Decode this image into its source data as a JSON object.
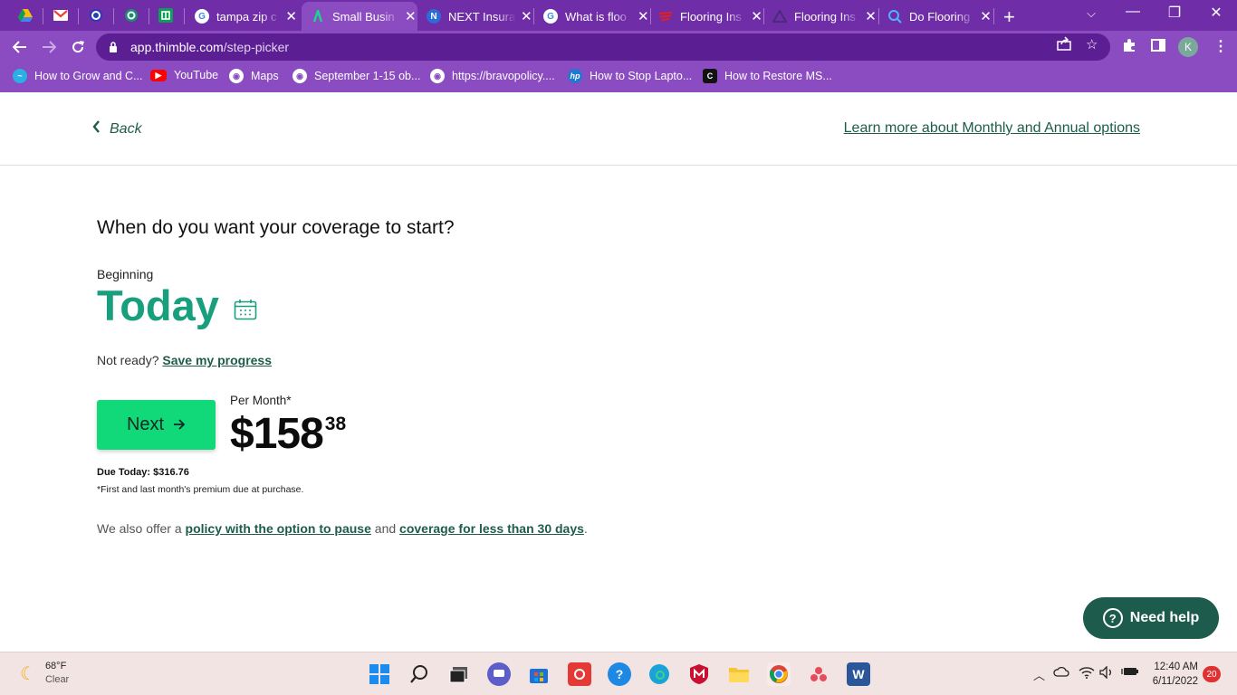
{
  "browser": {
    "tabs": [
      {
        "title": "tampa zip c",
        "favicon": "google-icon",
        "active": false
      },
      {
        "title": "Small Busin",
        "favicon": "thimble-icon",
        "active": true
      },
      {
        "title": "NEXT Insura",
        "favicon": "next-icon",
        "active": false
      },
      {
        "title": "What is floo",
        "favicon": "google-icon",
        "active": false
      },
      {
        "title": "Flooring Ins",
        "favicon": "flooring-icon",
        "active": false
      },
      {
        "title": "Flooring Ins",
        "favicon": "triangle-icon",
        "active": false
      },
      {
        "title": "Do Flooring",
        "favicon": "search-icon",
        "active": false
      }
    ],
    "url_host": "app.thimble.com",
    "url_path": "/step-picker",
    "profile_initial": "K",
    "bookmarks": [
      {
        "label": "How to Grow and C..."
      },
      {
        "label": "YouTube"
      },
      {
        "label": "Maps"
      },
      {
        "label": "September 1-15 ob..."
      },
      {
        "label": "https://bravopolicy...."
      },
      {
        "label": "How to Stop Lapto..."
      },
      {
        "label": "How to Restore MS..."
      }
    ],
    "colors": {
      "chrome": "#8b4cc2",
      "tabbar": "#6f2da8",
      "omnibox": "#5b1f93"
    }
  },
  "page": {
    "back_label": "Back",
    "learn_more_label": "Learn more about Monthly and Annual options",
    "question": "When do you want your coverage to start?",
    "beginning_label": "Beginning",
    "start_value": "Today",
    "not_ready_text": "Not ready?",
    "save_progress_label": "Save my progress",
    "next_label": "Next",
    "per_month_label": "Per Month*",
    "price_dollars": "$158",
    "price_cents": "38",
    "due_today": "Due Today: $316.76",
    "premium_note": "*First and last month's premium due at purchase.",
    "offer_prefix": "We also offer a",
    "offer_link1": "policy with the option to pause",
    "offer_mid": "and",
    "offer_link2": "coverage for less than 30 days",
    "offer_suffix": ".",
    "need_help_label": "Need help",
    "colors": {
      "brand_green": "#18a07e",
      "button_green": "#11d97a",
      "dark_green": "#1d5c4c"
    }
  },
  "taskbar": {
    "temperature": "68°F",
    "condition": "Clear",
    "time": "12:40 AM",
    "date": "6/11/2022",
    "notification_count": "20"
  }
}
